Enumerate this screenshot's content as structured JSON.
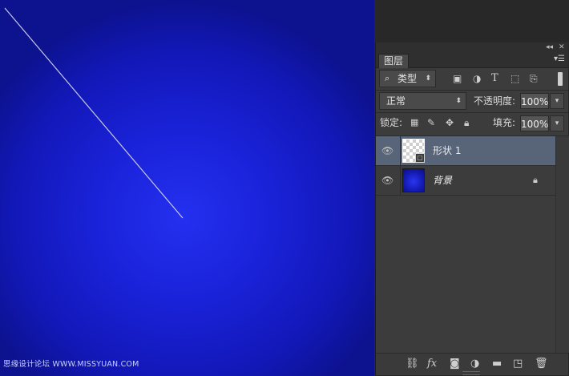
{
  "watermark": "思缘设计论坛 WWW.MISSYUAN.COM",
  "panel": {
    "tab_label": "图层",
    "titlebar_icons": [
      "collapse-icon",
      "close-icon"
    ],
    "panel_menu_icon": "menu-icon"
  },
  "filter": {
    "type_label": "类型",
    "icons": [
      "image-filter-icon",
      "adjustment-filter-icon",
      "text-filter-icon",
      "shape-filter-icon",
      "smart-object-filter-icon"
    ]
  },
  "blend": {
    "mode": "正常",
    "opacity_label": "不透明度:",
    "opacity_value": "100%"
  },
  "lock": {
    "label": "锁定:",
    "fill_label": "填充:",
    "fill_value": "100%",
    "icons": [
      "lock-transparent-icon",
      "lock-pixels-icon",
      "lock-position-icon",
      "lock-all-icon"
    ]
  },
  "layers": [
    {
      "name": "形状 1",
      "selected": true,
      "visible": true,
      "type": "shape"
    },
    {
      "name": "背景",
      "selected": false,
      "visible": true,
      "locked": true,
      "type": "background"
    }
  ],
  "bottom_toolbar": [
    "link-layers-icon",
    "fx-icon",
    "add-mask-icon",
    "adjustment-layer-icon",
    "new-group-icon",
    "new-layer-icon",
    "delete-layer-icon"
  ],
  "colors": {
    "canvas_blue": "#1a22d8",
    "selected_row": "#586478",
    "panel_bg": "#3c3c3c"
  }
}
